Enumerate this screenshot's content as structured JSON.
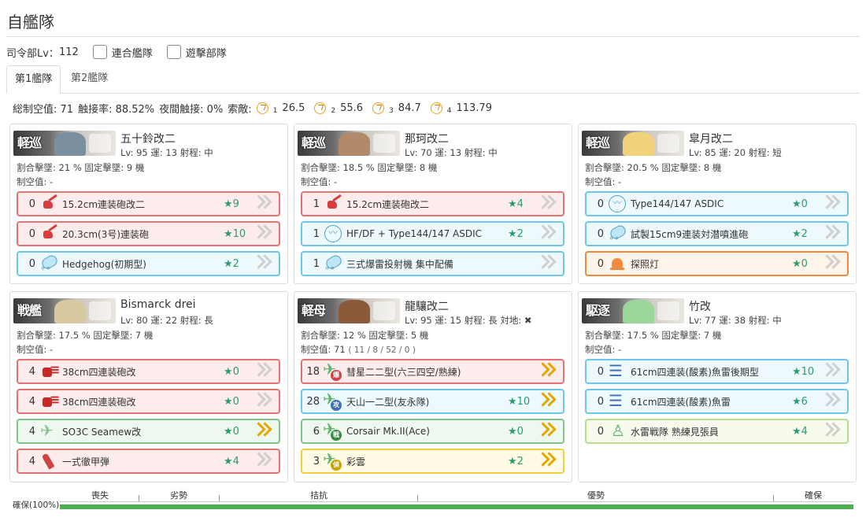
{
  "page": {
    "title": "自艦隊",
    "hq_level_label": "司令部Lv：",
    "hq_level": "112",
    "combined_fleet_label": "連合艦隊",
    "strike_force_label": "遊擊部隊"
  },
  "tabs": [
    "第1艦隊",
    "第2艦隊"
  ],
  "stats": {
    "air_power": "総制空值: 71",
    "contact": "触接率: 88.52%",
    "night_contact": "夜間触接: 0%",
    "los_label": "索敵:",
    "los": [
      {
        "sub": "1",
        "value": "26.5"
      },
      {
        "sub": "2",
        "value": "55.6"
      },
      {
        "sub": "3",
        "value": "84.7"
      },
      {
        "sub": "4",
        "value": "113.79"
      }
    ]
  },
  "ships": [
    {
      "type_label": "軽巡",
      "name": "五十鈴改二",
      "info": "Lv: 95  運: 13  射程: 中",
      "shoot_rate": "割合擊墜: 21 %  固定擊墜: 9 機",
      "air": "制空值: -",
      "equip": [
        {
          "count": "0",
          "name": "15.2cm連装砲改二",
          "star": "★9",
          "color": "red",
          "icon": "gun",
          "prof": "gray"
        },
        {
          "count": "0",
          "name": "20.3cm(3号)連装砲",
          "star": "★10",
          "color": "red",
          "icon": "gun",
          "prof": "gray"
        },
        {
          "count": "0",
          "name": "Hedgehog(初期型)",
          "star": "★2",
          "color": "blue",
          "icon": "dc",
          "prof": "gray"
        }
      ]
    },
    {
      "type_label": "軽巡",
      "name": "那珂改二",
      "info": "Lv: 70  運: 13  射程: 中",
      "shoot_rate": "割合擊墜: 18.5 %  固定擊墜: 8 機",
      "air": "制空值: -",
      "equip": [
        {
          "count": "1",
          "name": "15.2cm連装砲改二",
          "star": "★4",
          "color": "red",
          "icon": "gun",
          "prof": "gray"
        },
        {
          "count": "1",
          "name": "HF/DF + Type144/147 ASDIC",
          "star": "★2",
          "color": "blue",
          "icon": "sonar",
          "prof": "gray"
        },
        {
          "count": "1",
          "name": "三式爆雷投射機 集中配備",
          "star": "",
          "color": "blue",
          "icon": "dc",
          "prof": "gray"
        }
      ]
    },
    {
      "type_label": "軽巡",
      "name": "皐月改二",
      "info": "Lv: 85  運: 20  射程: 短",
      "shoot_rate": "割合擊墜: 20.5 %  固定擊墜: 8 機",
      "air": "制空值: -",
      "equip": [
        {
          "count": "0",
          "name": "Type144/147 ASDIC",
          "star": "★0",
          "color": "blue",
          "icon": "sonar",
          "prof": "gray"
        },
        {
          "count": "0",
          "name": "試製15cm9連装対潜噴進砲",
          "star": "★2",
          "color": "blue",
          "icon": "dc",
          "prof": "gray"
        },
        {
          "count": "0",
          "name": "探照灯",
          "star": "★0",
          "color": "orange",
          "icon": "light",
          "prof": "gray"
        }
      ]
    },
    {
      "type_label": "戦艦",
      "name": "Bismarck drei",
      "info": "Lv: 80  運: 22  射程: 長",
      "shoot_rate": "割合擊墜: 17.5 %  固定擊墜: 7 機",
      "air": "制空值: -",
      "equip": [
        {
          "count": "4",
          "name": "38cm四連装砲改",
          "star": "★0",
          "color": "red",
          "icon": "big",
          "prof": "gray"
        },
        {
          "count": "4",
          "name": "38cm四連装砲改",
          "star": "★0",
          "color": "red",
          "icon": "big",
          "prof": "gray"
        },
        {
          "count": "4",
          "name": "SO3C Seamew改",
          "star": "★0",
          "color": "green",
          "icon": "seaplane",
          "prof": "gold"
        },
        {
          "count": "4",
          "name": "一式徹甲弾",
          "star": "★4",
          "color": "red",
          "icon": "ap",
          "prof": "gray"
        }
      ]
    },
    {
      "type_label": "軽母",
      "name": "龍驤改二",
      "info": "Lv: 95  運: 15  射程: 長  対地: ✖",
      "shoot_rate": "割合擊墜: 12 %  固定擊墜: 5 機",
      "air": "制空值: 71",
      "air_detail": "( 11 / 8 / 52 / 0 )",
      "equip": [
        {
          "count": "18",
          "name": "彗星二二型(六三四空/熟練)",
          "star": "",
          "color": "red",
          "icon": "plane",
          "badge": "爆",
          "badge_color": "#c44",
          "prof": "gold"
        },
        {
          "count": "28",
          "name": "天山一二型(友永隊)",
          "star": "★10",
          "color": "blue",
          "icon": "plane",
          "badge": "攻",
          "badge_color": "#3f6fb5",
          "prof": "gold"
        },
        {
          "count": "6",
          "name": "Corsair Mk.II(Ace)",
          "star": "★0",
          "color": "green",
          "icon": "plane",
          "badge": "戦",
          "badge_color": "#3a8a44",
          "prof": "gold"
        },
        {
          "count": "3",
          "name": "彩雲",
          "star": "★2",
          "color": "yellow",
          "icon": "plane",
          "badge": "偵",
          "badge_color": "#c9a400",
          "prof": "gold"
        }
      ]
    },
    {
      "type_label": "駆逐",
      "name": "竹改",
      "info": "Lv: 77  運: 38  射程: 中",
      "shoot_rate": "割合擊墜: 17.5 %  固定擊墜: 7 機",
      "air": "制空值: -",
      "equip": [
        {
          "count": "0",
          "name": "61cm四連装(酸素)魚雷後期型",
          "star": "★10",
          "color": "blue",
          "icon": "torp",
          "prof": "gray"
        },
        {
          "count": "0",
          "name": "61cm四連装(酸素)魚雷",
          "star": "★6",
          "color": "blue",
          "icon": "torp",
          "prof": "gray"
        },
        {
          "count": "0",
          "name": "水雷戦隊 熟練見張員",
          "star": "★4",
          "color": "lgreen",
          "icon": "crew",
          "prof": "gray"
        }
      ]
    }
  ],
  "air_state": {
    "labels": [
      "喪失",
      "劣勢",
      "拮抗",
      "優勢",
      "確保"
    ],
    "current": "確保(100%)",
    "fill_fraction": 1.0,
    "bar_color": "#4caf50"
  }
}
